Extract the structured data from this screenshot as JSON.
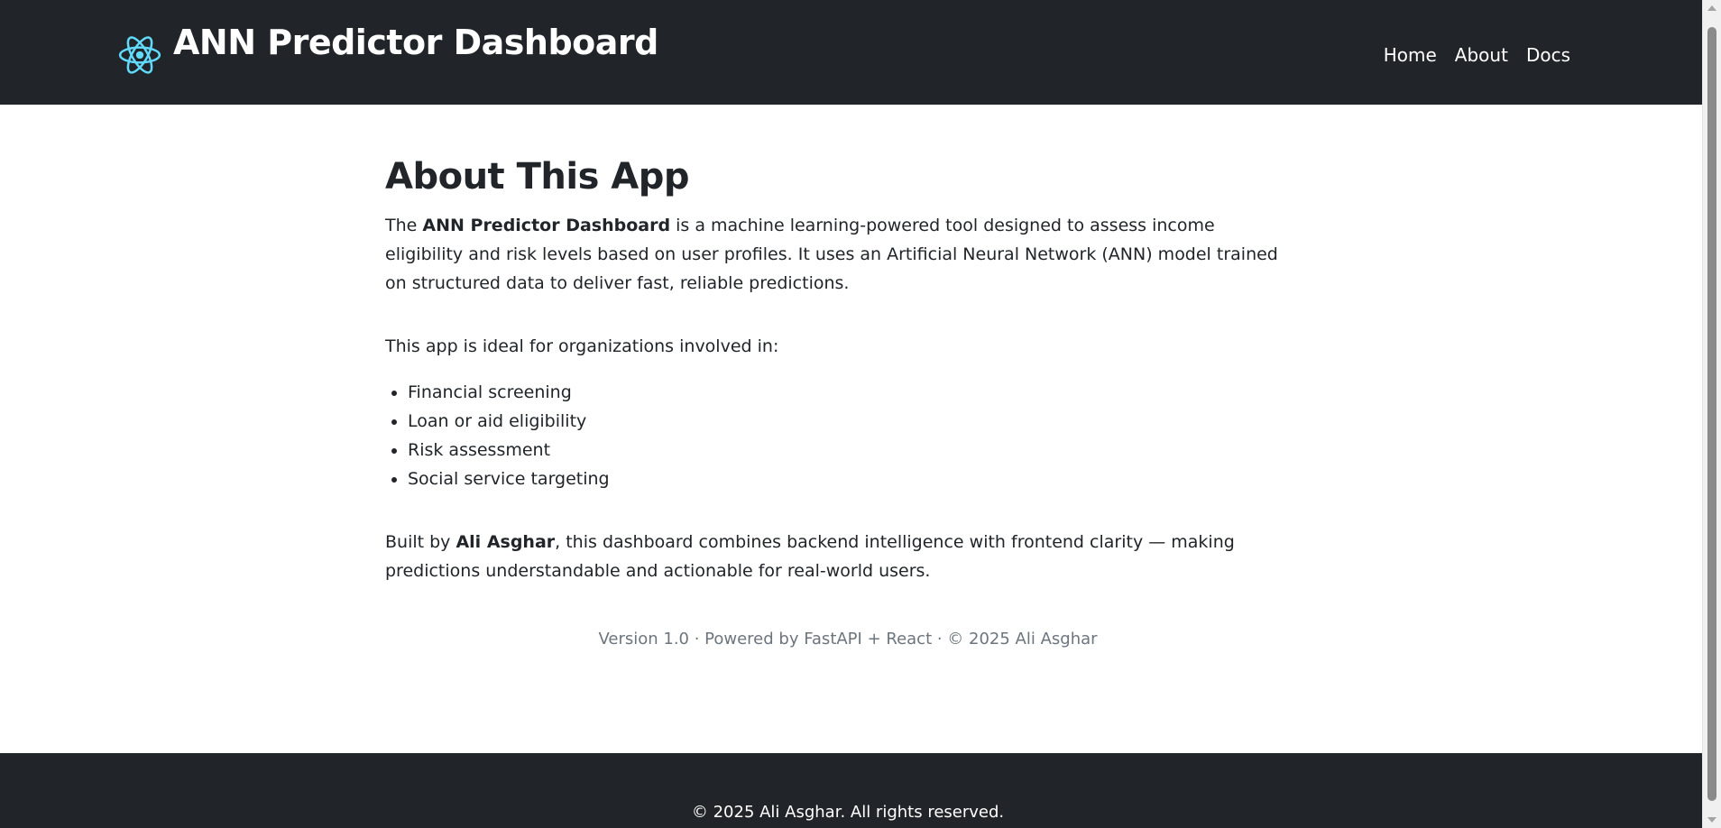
{
  "header": {
    "brand_icon": "react-atom-icon",
    "brand_color": "#61dafb",
    "title": "ANN Predictor Dashboard",
    "nav": [
      {
        "label": "Home"
      },
      {
        "label": "About"
      },
      {
        "label": "Docs"
      }
    ]
  },
  "main": {
    "title": "About This App",
    "intro": {
      "pre": "The ",
      "bold": "ANN Predictor Dashboard",
      "post": " is a machine learning-powered tool designed to assess income eligibility and risk levels based on user profiles. It uses an Artificial Neural Network (ANN) model trained on structured data to deliver fast, reliable predictions."
    },
    "ideal_text": "This app is ideal for organizations involved in:",
    "use_cases": [
      "Financial screening",
      "Loan or aid eligibility",
      "Risk assessment",
      "Social service targeting"
    ],
    "built": {
      "pre": "Built by ",
      "bold": "Ali Asghar",
      "post": ", this dashboard combines backend intelligence with frontend clarity — making predictions understandable and actionable for real-world users."
    },
    "version_line": "Version 1.0 · Powered by FastAPI + React · © 2025 Ali Asghar"
  },
  "footer": {
    "text": "© 2025 Ali Asghar. All rights reserved."
  },
  "colors": {
    "navbar_bg": "#212529",
    "text": "#212529",
    "muted": "#6c757d"
  }
}
